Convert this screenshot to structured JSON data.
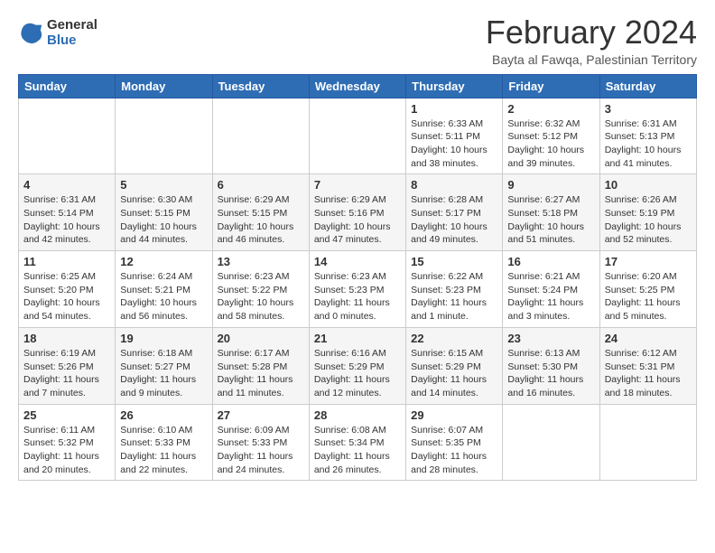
{
  "logo": {
    "general": "General",
    "blue": "Blue"
  },
  "title": "February 2024",
  "location": "Bayta al Fawqa, Palestinian Territory",
  "headers": [
    "Sunday",
    "Monday",
    "Tuesday",
    "Wednesday",
    "Thursday",
    "Friday",
    "Saturday"
  ],
  "weeks": [
    [
      {
        "day": "",
        "info": ""
      },
      {
        "day": "",
        "info": ""
      },
      {
        "day": "",
        "info": ""
      },
      {
        "day": "",
        "info": ""
      },
      {
        "day": "1",
        "info": "Sunrise: 6:33 AM\nSunset: 5:11 PM\nDaylight: 10 hours and 38 minutes."
      },
      {
        "day": "2",
        "info": "Sunrise: 6:32 AM\nSunset: 5:12 PM\nDaylight: 10 hours and 39 minutes."
      },
      {
        "day": "3",
        "info": "Sunrise: 6:31 AM\nSunset: 5:13 PM\nDaylight: 10 hours and 41 minutes."
      }
    ],
    [
      {
        "day": "4",
        "info": "Sunrise: 6:31 AM\nSunset: 5:14 PM\nDaylight: 10 hours and 42 minutes."
      },
      {
        "day": "5",
        "info": "Sunrise: 6:30 AM\nSunset: 5:15 PM\nDaylight: 10 hours and 44 minutes."
      },
      {
        "day": "6",
        "info": "Sunrise: 6:29 AM\nSunset: 5:15 PM\nDaylight: 10 hours and 46 minutes."
      },
      {
        "day": "7",
        "info": "Sunrise: 6:29 AM\nSunset: 5:16 PM\nDaylight: 10 hours and 47 minutes."
      },
      {
        "day": "8",
        "info": "Sunrise: 6:28 AM\nSunset: 5:17 PM\nDaylight: 10 hours and 49 minutes."
      },
      {
        "day": "9",
        "info": "Sunrise: 6:27 AM\nSunset: 5:18 PM\nDaylight: 10 hours and 51 minutes."
      },
      {
        "day": "10",
        "info": "Sunrise: 6:26 AM\nSunset: 5:19 PM\nDaylight: 10 hours and 52 minutes."
      }
    ],
    [
      {
        "day": "11",
        "info": "Sunrise: 6:25 AM\nSunset: 5:20 PM\nDaylight: 10 hours and 54 minutes."
      },
      {
        "day": "12",
        "info": "Sunrise: 6:24 AM\nSunset: 5:21 PM\nDaylight: 10 hours and 56 minutes."
      },
      {
        "day": "13",
        "info": "Sunrise: 6:23 AM\nSunset: 5:22 PM\nDaylight: 10 hours and 58 minutes."
      },
      {
        "day": "14",
        "info": "Sunrise: 6:23 AM\nSunset: 5:23 PM\nDaylight: 11 hours and 0 minutes."
      },
      {
        "day": "15",
        "info": "Sunrise: 6:22 AM\nSunset: 5:23 PM\nDaylight: 11 hours and 1 minute."
      },
      {
        "day": "16",
        "info": "Sunrise: 6:21 AM\nSunset: 5:24 PM\nDaylight: 11 hours and 3 minutes."
      },
      {
        "day": "17",
        "info": "Sunrise: 6:20 AM\nSunset: 5:25 PM\nDaylight: 11 hours and 5 minutes."
      }
    ],
    [
      {
        "day": "18",
        "info": "Sunrise: 6:19 AM\nSunset: 5:26 PM\nDaylight: 11 hours and 7 minutes."
      },
      {
        "day": "19",
        "info": "Sunrise: 6:18 AM\nSunset: 5:27 PM\nDaylight: 11 hours and 9 minutes."
      },
      {
        "day": "20",
        "info": "Sunrise: 6:17 AM\nSunset: 5:28 PM\nDaylight: 11 hours and 11 minutes."
      },
      {
        "day": "21",
        "info": "Sunrise: 6:16 AM\nSunset: 5:29 PM\nDaylight: 11 hours and 12 minutes."
      },
      {
        "day": "22",
        "info": "Sunrise: 6:15 AM\nSunset: 5:29 PM\nDaylight: 11 hours and 14 minutes."
      },
      {
        "day": "23",
        "info": "Sunrise: 6:13 AM\nSunset: 5:30 PM\nDaylight: 11 hours and 16 minutes."
      },
      {
        "day": "24",
        "info": "Sunrise: 6:12 AM\nSunset: 5:31 PM\nDaylight: 11 hours and 18 minutes."
      }
    ],
    [
      {
        "day": "25",
        "info": "Sunrise: 6:11 AM\nSunset: 5:32 PM\nDaylight: 11 hours and 20 minutes."
      },
      {
        "day": "26",
        "info": "Sunrise: 6:10 AM\nSunset: 5:33 PM\nDaylight: 11 hours and 22 minutes."
      },
      {
        "day": "27",
        "info": "Sunrise: 6:09 AM\nSunset: 5:33 PM\nDaylight: 11 hours and 24 minutes."
      },
      {
        "day": "28",
        "info": "Sunrise: 6:08 AM\nSunset: 5:34 PM\nDaylight: 11 hours and 26 minutes."
      },
      {
        "day": "29",
        "info": "Sunrise: 6:07 AM\nSunset: 5:35 PM\nDaylight: 11 hours and 28 minutes."
      },
      {
        "day": "",
        "info": ""
      },
      {
        "day": "",
        "info": ""
      }
    ]
  ]
}
